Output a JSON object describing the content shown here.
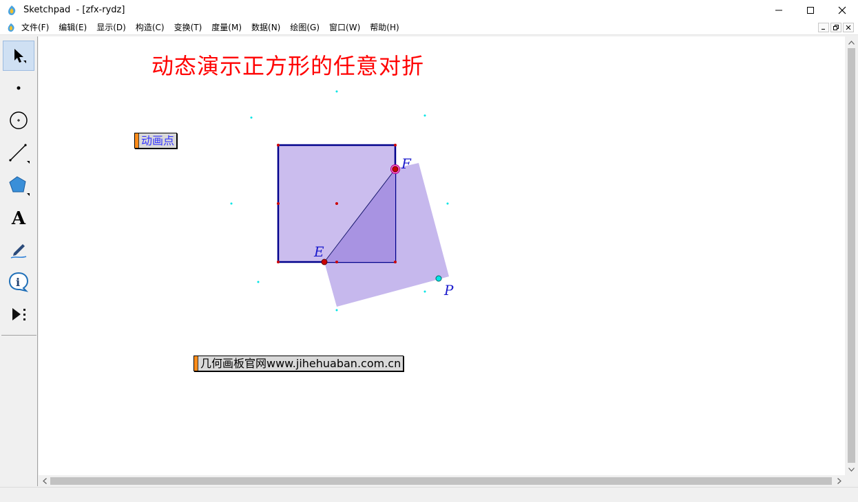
{
  "window": {
    "app_name": "Sketchpad",
    "document_name": "  - [zfx-rydz]"
  },
  "menu": {
    "items": [
      "文件(F)",
      "编辑(E)",
      "显示(D)",
      "构造(C)",
      "变换(T)",
      "度量(M)",
      "数据(N)",
      "绘图(G)",
      "窗口(W)",
      "帮助(H)"
    ]
  },
  "toolbox": {
    "tools": [
      "arrow-select-icon",
      "point-icon",
      "compass-icon",
      "straightedge-icon",
      "polygon-icon",
      "text-icon",
      "marker-icon",
      "information-icon",
      "custom-tools-icon"
    ],
    "selected": "arrow-select-icon"
  },
  "sketch": {
    "title": "动态演示正方形的任意对折",
    "animate_button": "动画点",
    "link_button": "几何画板官网www.jihehuaban.com.cn",
    "point_labels": {
      "E": "E",
      "F": "F",
      "P": "P"
    },
    "colors": {
      "title": "#ff0000",
      "square_fill": "#cbbdee",
      "square_border": "#00008b",
      "folded_fill": "#c2b3ec",
      "overlap_fill": "#a893e2",
      "point_red": "#cc0000",
      "point_cyan": "#00e5e5",
      "label_blue": "#1a1acc",
      "button_handle": "#ff8c1a"
    }
  }
}
